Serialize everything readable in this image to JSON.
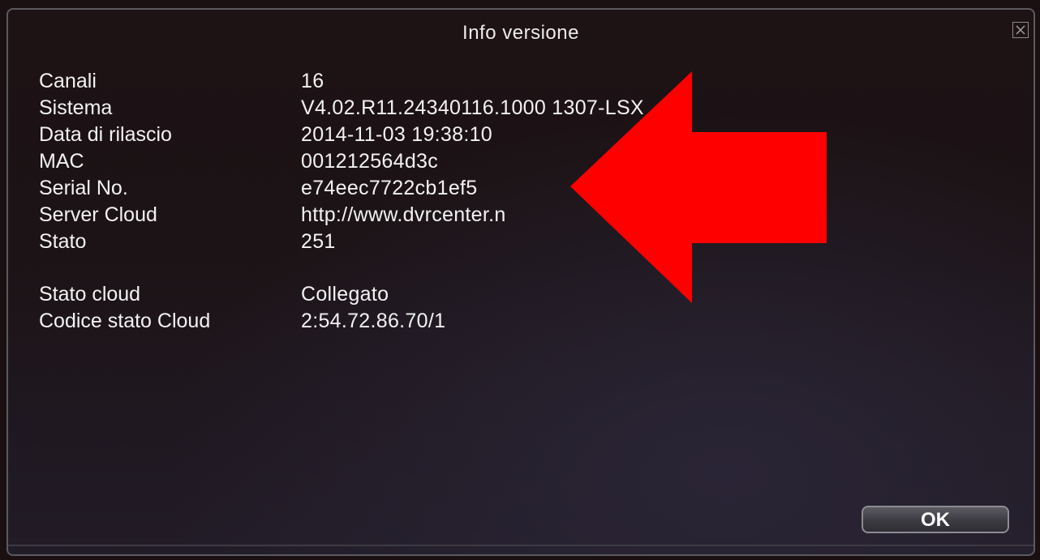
{
  "dialog": {
    "title": "Info versione",
    "ok_label": "OK"
  },
  "info": [
    {
      "label": "Canali",
      "value": "16"
    },
    {
      "label": "Sistema",
      "value": "V4.02.R11.24340116.1000 1307-LSX"
    },
    {
      "label": "Data di rilascio",
      "value": "2014-11-03 19:38:10"
    },
    {
      "label": "MAC",
      "value": "001212564d3c"
    },
    {
      "label": "Serial No.",
      "value": "e74eec7722cb1ef5"
    },
    {
      "label": "Server Cloud",
      "value": "http://www.dvrcenter.n"
    },
    {
      "label": "Stato",
      "value": "251"
    },
    {
      "label": "Stato cloud",
      "value": "Collegato"
    },
    {
      "label": "Codice stato Cloud",
      "value": "2:54.72.86.70/1"
    }
  ],
  "annotation": {
    "arrow_color": "#ff0000"
  }
}
